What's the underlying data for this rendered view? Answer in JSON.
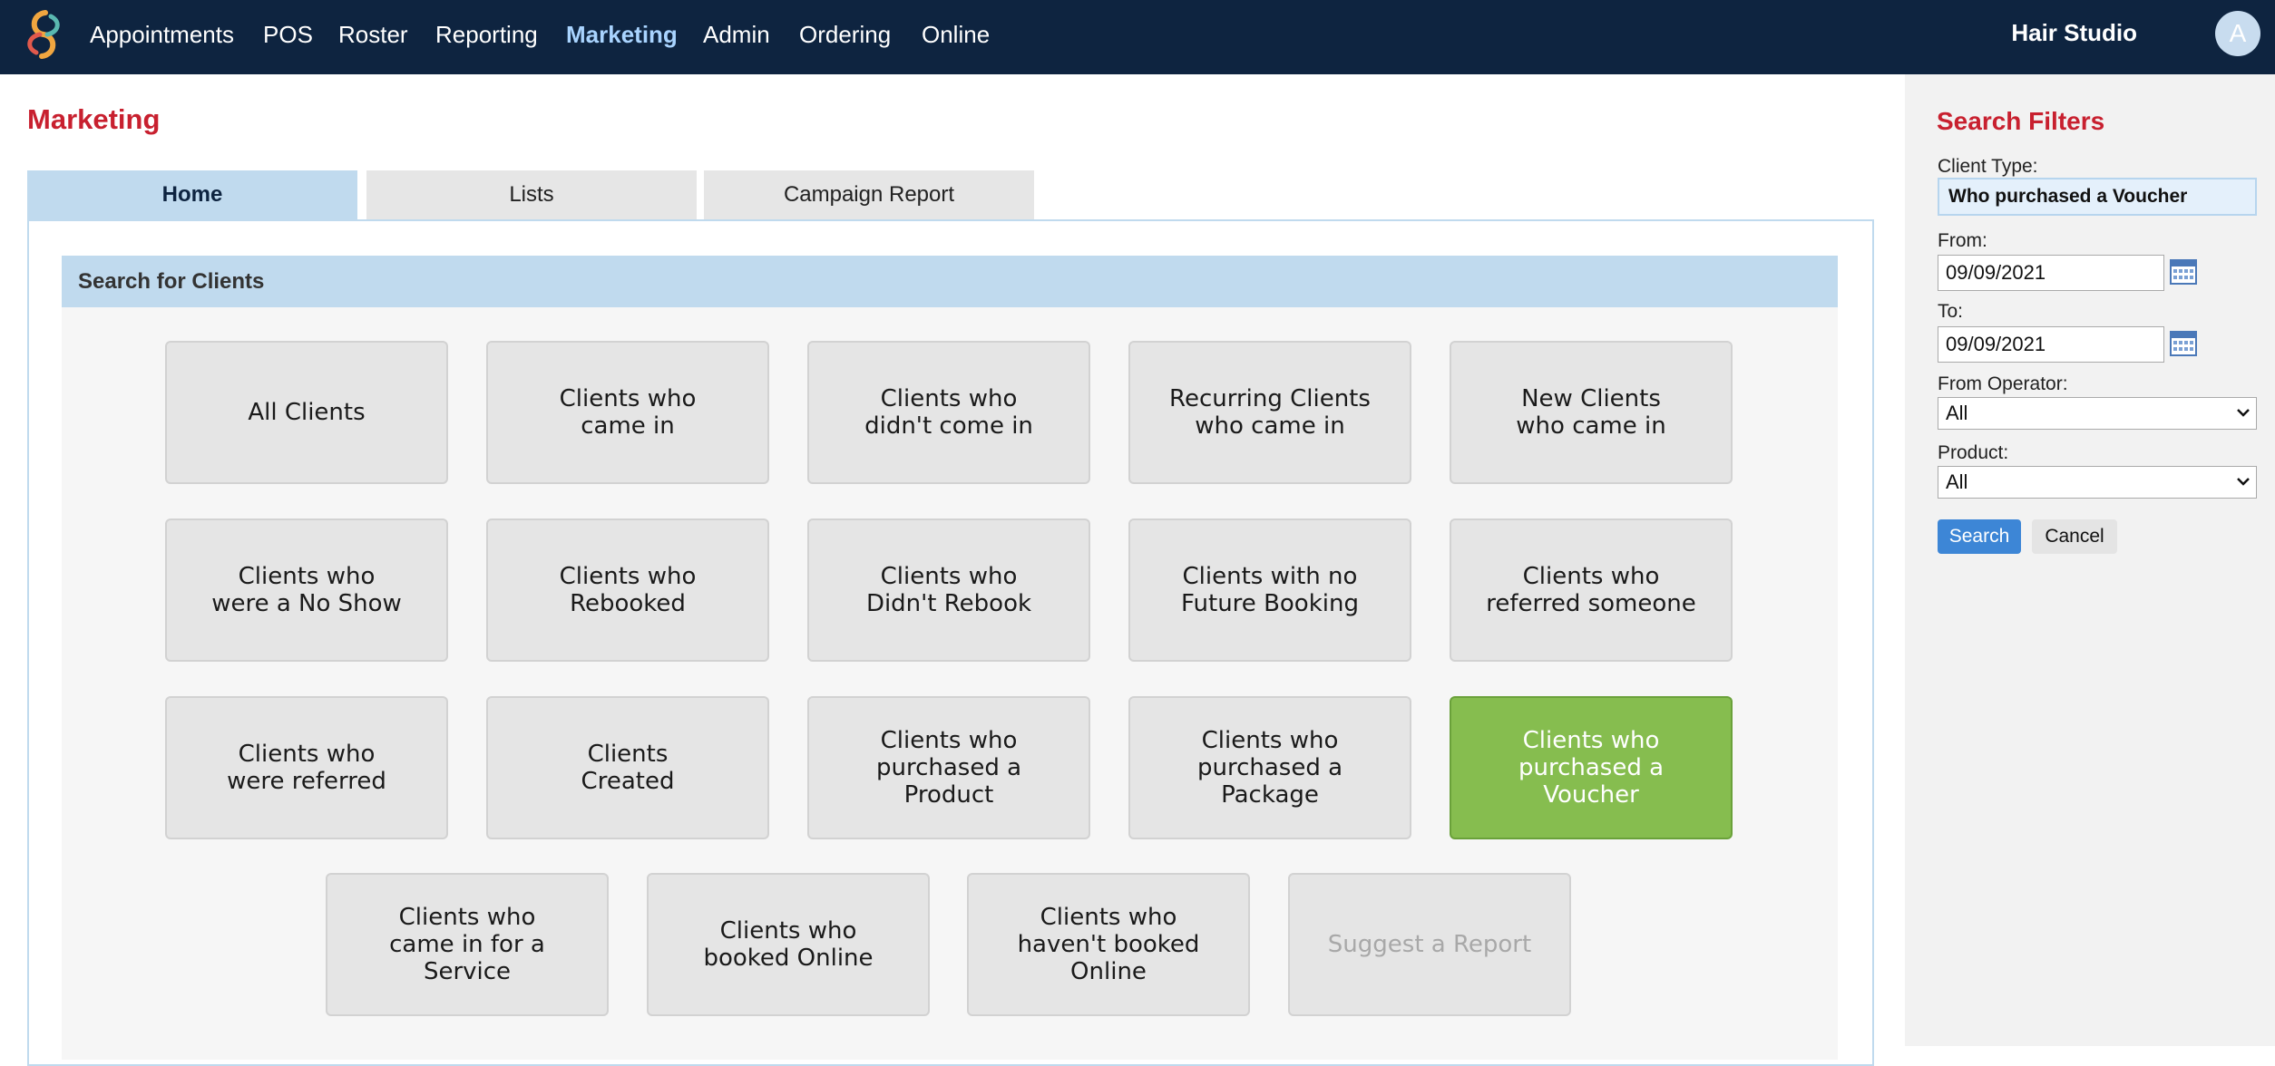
{
  "nav": {
    "items": [
      {
        "label": "Appointments",
        "active": false
      },
      {
        "label": "POS",
        "active": false
      },
      {
        "label": "Roster",
        "active": false
      },
      {
        "label": "Reporting",
        "active": false
      },
      {
        "label": "Marketing",
        "active": true
      },
      {
        "label": "Admin",
        "active": false
      },
      {
        "label": "Ordering",
        "active": false
      },
      {
        "label": "Online",
        "active": false
      }
    ],
    "business_name": "Hair Studio",
    "avatar_initial": "A"
  },
  "page": {
    "title": "Marketing",
    "tabs": [
      {
        "label": "Home",
        "active": true
      },
      {
        "label": "Lists",
        "active": false
      },
      {
        "label": "Campaign Report",
        "active": false
      }
    ],
    "section_title": "Search for Clients"
  },
  "reports": [
    {
      "label": "All Clients"
    },
    {
      "label": "Clients who\ncame in"
    },
    {
      "label": "Clients who\ndidn't come in"
    },
    {
      "label": "Recurring Clients\nwho came in"
    },
    {
      "label": "New Clients\nwho came in"
    },
    {
      "label": "Clients who\nwere a No Show"
    },
    {
      "label": "Clients who\nRebooked"
    },
    {
      "label": "Clients who\nDidn't Rebook"
    },
    {
      "label": "Clients with no\nFuture Booking"
    },
    {
      "label": "Clients who\nreferred someone"
    },
    {
      "label": "Clients who\nwere referred"
    },
    {
      "label": "Clients\nCreated"
    },
    {
      "label": "Clients who\npurchased a\nProduct"
    },
    {
      "label": "Clients who\npurchased a\nPackage"
    },
    {
      "label": "Clients who\npurchased a\nVoucher",
      "selected": true
    },
    {
      "label": "Clients who\ncame in for a\nService"
    },
    {
      "label": "Clients who\nbooked Online"
    },
    {
      "label": "Clients who\nhaven't booked\nOnline"
    },
    {
      "label": "Suggest a Report",
      "disabled": true
    }
  ],
  "filters": {
    "title": "Search Filters",
    "client_type_label": "Client Type:",
    "client_type_value": "Who purchased a Voucher",
    "from_label": "From:",
    "from_value": "09/09/2021",
    "to_label": "To:",
    "to_value": "09/09/2021",
    "operator_label": "From Operator:",
    "operator_value": "All",
    "product_label": "Product:",
    "product_value": "All",
    "search_label": "Search",
    "cancel_label": "Cancel"
  },
  "colors": {
    "nav_bg": "#0e2440",
    "accent_red": "#c8202f",
    "tab_active": "#c0daee",
    "selected_green": "#86bd4f",
    "search_blue": "#3d86d6"
  }
}
